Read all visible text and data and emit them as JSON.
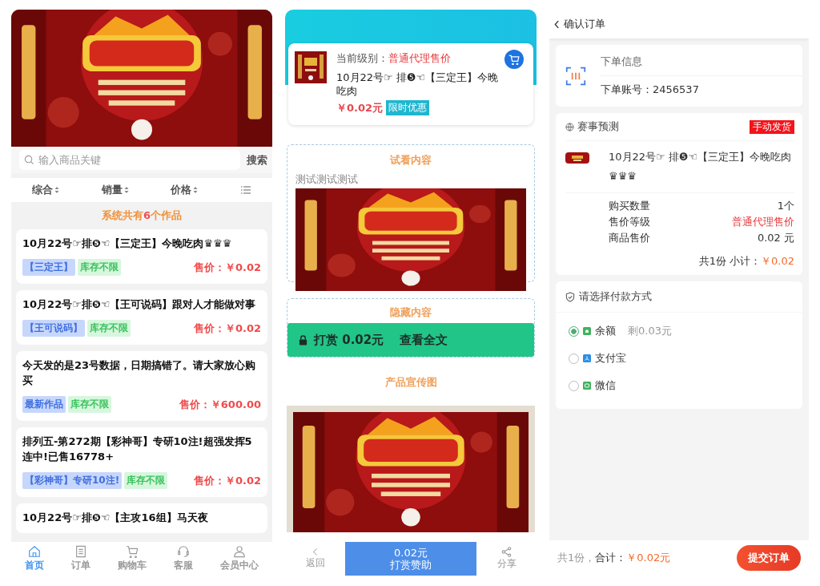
{
  "home": {
    "search": {
      "placeholder": "输入商品关键",
      "button": "搜索"
    },
    "sort": [
      {
        "kind": "sort",
        "label": "综合"
      },
      {
        "kind": "sort",
        "label": "销量"
      },
      {
        "kind": "sort",
        "label": "价格"
      },
      {
        "kind": "view"
      }
    ],
    "count": {
      "before": "系统共有",
      "number": "6",
      "after": "个作品"
    },
    "products": [
      {
        "title": "10月22号☞排❺☜【三定王】今晚吃肉♛♛♛",
        "tags": [
          {
            "kind": "category",
            "label": "【三定王】"
          },
          {
            "kind": "stock",
            "label": "库存不限"
          }
        ],
        "price": "售价：￥0.02"
      },
      {
        "title": "10月22号☞排❺☜【王可说码】跟对人才能做对事",
        "tags": [
          {
            "kind": "category",
            "label": "【王可说码】"
          },
          {
            "kind": "stock",
            "label": "库存不限"
          }
        ],
        "price": "售价：￥0.02"
      },
      {
        "title": "今天发的是23号数据，日期搞错了。请大家放心购买",
        "tags": [
          {
            "kind": "category",
            "label": "最新作品"
          },
          {
            "kind": "stock",
            "label": "库存不限"
          }
        ],
        "price": "售价：￥600.00"
      },
      {
        "title": "排列五-第272期【彩神哥】专研10注!超强发挥5连中!已售16778+",
        "tags": [
          {
            "kind": "category",
            "label": "【彩神哥】专研10注!"
          },
          {
            "kind": "stock",
            "label": "库存不限"
          }
        ],
        "price": "售价：￥0.02"
      },
      {
        "title": "10月22号☞排❺☜【主攻16组】马天夜"
      }
    ],
    "nav": [
      {
        "kind": "home",
        "label": "首页",
        "selected": true
      },
      {
        "kind": "orders",
        "label": "订单",
        "selected": false
      },
      {
        "kind": "cart",
        "label": "购物车",
        "selected": false
      },
      {
        "kind": "service",
        "label": "客服",
        "selected": false
      },
      {
        "kind": "member",
        "label": "会员中心",
        "selected": false
      }
    ]
  },
  "detail": {
    "level_label": "当前级别：",
    "level": "普通代理售价",
    "title": "10月22号☞ 排❺☜【三定王】今晚吃肉",
    "price": "￥0.02元",
    "promo": "限时优惠",
    "preview": {
      "heading": "试看内容",
      "text": "测试测试测试"
    },
    "hidden": {
      "heading": "隐藏内容",
      "pay": "打赏 0.02元",
      "view": "查看全文"
    },
    "promo_heading": "产品宣传图",
    "bottom": {
      "back": "返回",
      "amount": "0.02元",
      "reward": "打赏赞助",
      "share": "分享"
    }
  },
  "order": {
    "title": "确认订单",
    "info_heading": "下单信息",
    "account": "下单账号：2456537",
    "category": "赛事预测",
    "delivery": "手动发货",
    "item_title": "10月22号☞ 排❺☜【三定王】今晚吃肉♛♛♛",
    "rows": [
      {
        "label": "购买数量",
        "value": "1个",
        "highlight": false
      },
      {
        "label": "售价等级",
        "value": "普通代理售价",
        "highlight": true
      },
      {
        "label": "商品售价",
        "value": "0.02 元",
        "highlight": false
      }
    ],
    "subtotal_label": "共1份 小计：",
    "subtotal": "￥0.02",
    "pay_heading": "请选择付款方式",
    "methods": [
      {
        "kind": "balance",
        "label": "余额",
        "note": "剩0.03元",
        "selected": true
      },
      {
        "kind": "alipay",
        "label": "支付宝",
        "selected": false
      },
      {
        "kind": "wechat",
        "label": "微信",
        "selected": false
      }
    ],
    "footer": {
      "count": "共1份，",
      "total_label": "合计：",
      "total": "￥0.02元"
    },
    "submit": "提交订单"
  }
}
